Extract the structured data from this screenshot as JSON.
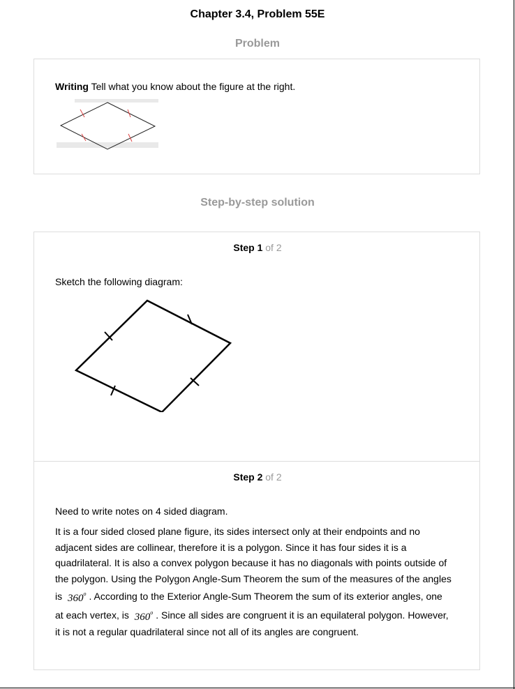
{
  "header": {
    "title": "Chapter 3.4, Problem 55E"
  },
  "problem": {
    "heading": "Problem",
    "bold_lead": "Writing",
    "text": " Tell what you know about the figure at the right."
  },
  "solution": {
    "heading": "Step-by-step solution",
    "steps": [
      {
        "label": "Step 1",
        "of": " of 2",
        "text": "Sketch the following diagram:"
      },
      {
        "label": "Step 2",
        "of": " of 2",
        "intro": "Need to write notes on 4 sided diagram.",
        "para_1": "It is a four sided closed plane figure, its sides intersect only at their endpoints and no",
        "para_2": "adjacent sides are collinear, therefore it is a polygon. Since it has four sides it is a",
        "para_3": "quadrilateral. It is also a convex polygon because it has no diagonals with points outside of",
        "para_4": "the polygon. Using the Polygon Angle-Sum Theorem the sum of the measures of the angles",
        "para_5a": "is",
        "math_1": "360",
        "math_sup": "o",
        "para_5b": ". According to the Exterior Angle-Sum Theorem the sum of its exterior angles, one",
        "para_6a": "at each vertex, is",
        "math_2": "360",
        "para_6b": ". Since all sides are congruent it is an equilateral polygon. However,",
        "para_7": "it is not a regular quadrilateral since not all of its angles are congruent."
      }
    ]
  }
}
